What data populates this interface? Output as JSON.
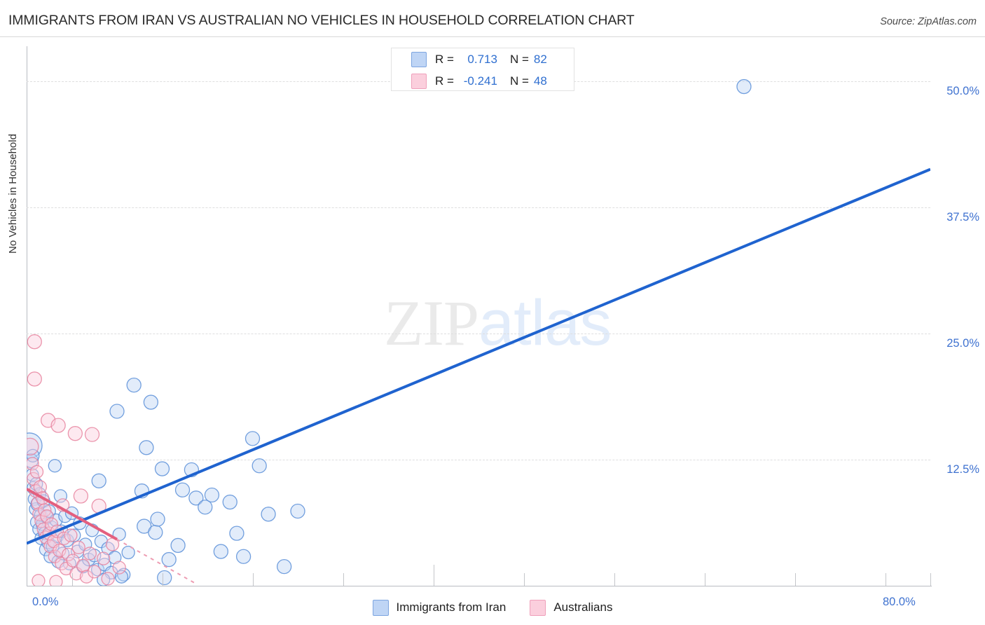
{
  "header": {
    "title": "IMMIGRANTS FROM IRAN VS AUSTRALIAN NO VEHICLES IN HOUSEHOLD CORRELATION CHART",
    "source": "Source: ZipAtlas.com"
  },
  "watermark": {
    "part1": "ZIP",
    "part2": "atlas"
  },
  "stats_legend": {
    "rows": [
      {
        "color": "#bfd5f5",
        "r_label": "R =",
        "r_value": "0.713",
        "n_label": "N =",
        "n_value": "82"
      },
      {
        "color": "#fbcfdd",
        "r_label": "R =",
        "r_value": "-0.241",
        "n_label": "N =",
        "n_value": "48"
      }
    ]
  },
  "bottom_legend": {
    "items": [
      {
        "label": "Immigrants from Iran",
        "color": "#bfd5f5",
        "border": "#7da5e0"
      },
      {
        "label": "Australians",
        "color": "#fbcfdd",
        "border": "#efa0bb"
      }
    ]
  },
  "chart_data": {
    "type": "scatter",
    "title": "IMMIGRANTS FROM IRAN VS AUSTRALIAN NO VEHICLES IN HOUSEHOLD CORRELATION CHART",
    "xlabel": "",
    "ylabel": "No Vehicles in Household",
    "xlim": [
      0,
      80
    ],
    "ylim": [
      0,
      53.5
    ],
    "grid": true,
    "legend_position": "bottom-center",
    "y_ticks": [
      {
        "value": 50.0,
        "label": "50.0%"
      },
      {
        "value": 37.5,
        "label": "37.5%"
      },
      {
        "value": 25.0,
        "label": "25.0%"
      },
      {
        "value": 12.5,
        "label": "12.5%"
      }
    ],
    "x_ticks": [
      {
        "value": 0,
        "label": "0.0%"
      },
      {
        "value": 80,
        "label": "80.0%"
      }
    ],
    "x_tick_marks": [
      4,
      12,
      20,
      28,
      36,
      44,
      52,
      60,
      68,
      76,
      80
    ],
    "series": [
      {
        "name": "Immigrants from Iran",
        "color": "#bfd5f5",
        "border": "#5b8fd8",
        "r": 0.713,
        "n": 82,
        "trendline": {
          "x0": 0,
          "y0": 4.2,
          "x1": 80,
          "y1": 41.3,
          "color": "#1f63cf",
          "style": "solid"
        },
        "points": [
          [
            0.25,
            13.9,
            18
          ],
          [
            0.4,
            12.4,
            10
          ],
          [
            0.5,
            11.0,
            9
          ],
          [
            0.55,
            12.9,
            9
          ],
          [
            0.6,
            9.7,
            9
          ],
          [
            0.7,
            8.6,
            9
          ],
          [
            0.8,
            7.6,
            9
          ],
          [
            0.85,
            10.1,
            9
          ],
          [
            0.9,
            6.3,
            9
          ],
          [
            1.0,
            8.1,
            10
          ],
          [
            1.1,
            5.6,
            9
          ],
          [
            1.15,
            9.1,
            9
          ],
          [
            1.25,
            7.0,
            9
          ],
          [
            1.3,
            4.7,
            9
          ],
          [
            1.4,
            6.1,
            9
          ],
          [
            1.5,
            8.4,
            9
          ],
          [
            1.6,
            5.2,
            9
          ],
          [
            1.7,
            3.6,
            9
          ],
          [
            1.8,
            6.8,
            9
          ],
          [
            1.9,
            4.3,
            9
          ],
          [
            2.0,
            7.4,
            9
          ],
          [
            2.1,
            2.9,
            9
          ],
          [
            2.2,
            5.8,
            9
          ],
          [
            2.3,
            3.9,
            9
          ],
          [
            2.5,
            11.9,
            9
          ],
          [
            2.6,
            6.5,
            9
          ],
          [
            2.7,
            4.9,
            9
          ],
          [
            2.8,
            2.4,
            9
          ],
          [
            3.0,
            8.9,
            9
          ],
          [
            3.1,
            5.4,
            9
          ],
          [
            3.2,
            3.2,
            9
          ],
          [
            3.4,
            6.9,
            9
          ],
          [
            3.6,
            4.5,
            9
          ],
          [
            3.8,
            2.2,
            9
          ],
          [
            4.0,
            7.2,
            9
          ],
          [
            4.2,
            5.0,
            9
          ],
          [
            4.5,
            3.4,
            9
          ],
          [
            4.7,
            6.2,
            9
          ],
          [
            5.0,
            1.9,
            9
          ],
          [
            5.2,
            4.1,
            9
          ],
          [
            5.5,
            2.6,
            9
          ],
          [
            5.8,
            5.5,
            9
          ],
          [
            6.0,
            3.0,
            9
          ],
          [
            6.3,
            1.6,
            9
          ],
          [
            6.6,
            4.4,
            9
          ],
          [
            6.9,
            2.1,
            9
          ],
          [
            7.2,
            3.7,
            9
          ],
          [
            7.5,
            1.3,
            9
          ],
          [
            6.4,
            10.4,
            10
          ],
          [
            7.8,
            2.8,
            9
          ],
          [
            8.2,
            5.1,
            9
          ],
          [
            8.6,
            1.1,
            9
          ],
          [
            9.0,
            3.3,
            9
          ],
          [
            8.0,
            17.3,
            10
          ],
          [
            9.5,
            19.9,
            10
          ],
          [
            10.6,
            13.7,
            10
          ],
          [
            11.0,
            18.2,
            10
          ],
          [
            10.2,
            9.4,
            10
          ],
          [
            10.4,
            5.9,
            10
          ],
          [
            11.4,
            5.3,
            10
          ],
          [
            11.6,
            6.6,
            10
          ],
          [
            12.0,
            11.6,
            10
          ],
          [
            12.6,
            2.6,
            10
          ],
          [
            13.4,
            4.0,
            10
          ],
          [
            13.8,
            9.5,
            10
          ],
          [
            14.6,
            11.5,
            10
          ],
          [
            15.0,
            8.7,
            10
          ],
          [
            15.8,
            7.8,
            10
          ],
          [
            16.4,
            9.0,
            10
          ],
          [
            17.2,
            3.4,
            10
          ],
          [
            18.0,
            8.3,
            10
          ],
          [
            18.6,
            5.2,
            10
          ],
          [
            19.2,
            2.9,
            10
          ],
          [
            20.0,
            14.6,
            10
          ],
          [
            20.6,
            11.9,
            10
          ],
          [
            21.4,
            7.1,
            10
          ],
          [
            22.8,
            1.9,
            10
          ],
          [
            24.0,
            7.4,
            10
          ],
          [
            12.2,
            0.8,
            10
          ],
          [
            6.8,
            0.6,
            9
          ],
          [
            8.4,
            0.9,
            9
          ],
          [
            63.5,
            49.5,
            10
          ]
        ]
      },
      {
        "name": "Australians",
        "color": "#fbcfdd",
        "border": "#e8849f",
        "r": -0.241,
        "n": 48,
        "trendline": {
          "x0": 0,
          "y0": 9.6,
          "x1": 8.0,
          "y1": 4.6,
          "color": "#e3607f",
          "style": "solid"
        },
        "trendline_dashed": {
          "x0": 8.0,
          "y0": 4.6,
          "x1": 15.0,
          "y1": 0.2,
          "color": "#ee9cb2",
          "style": "dashed"
        },
        "points": [
          [
            0.7,
            24.2,
            10
          ],
          [
            0.7,
            20.5,
            10
          ],
          [
            1.9,
            16.4,
            10
          ],
          [
            2.8,
            15.9,
            10
          ],
          [
            4.3,
            15.1,
            10
          ],
          [
            5.8,
            15.0,
            10
          ],
          [
            0.3,
            13.8,
            12
          ],
          [
            0.5,
            12.1,
            9
          ],
          [
            0.6,
            10.6,
            9
          ],
          [
            0.8,
            9.4,
            9
          ],
          [
            0.9,
            11.3,
            9
          ],
          [
            1.0,
            8.2,
            9
          ],
          [
            1.1,
            7.1,
            9
          ],
          [
            1.2,
            9.8,
            9
          ],
          [
            1.3,
            6.4,
            9
          ],
          [
            1.4,
            8.7,
            9
          ],
          [
            1.5,
            5.6,
            9
          ],
          [
            1.6,
            7.5,
            9
          ],
          [
            1.7,
            4.8,
            9
          ],
          [
            1.8,
            6.9,
            9
          ],
          [
            2.0,
            5.2,
            9
          ],
          [
            2.1,
            3.9,
            9
          ],
          [
            2.2,
            6.1,
            9
          ],
          [
            2.4,
            4.4,
            9
          ],
          [
            2.5,
            2.9,
            9
          ],
          [
            2.7,
            5.4,
            9
          ],
          [
            2.9,
            3.5,
            9
          ],
          [
            3.1,
            2.2,
            9
          ],
          [
            3.3,
            4.7,
            9
          ],
          [
            3.5,
            1.7,
            9
          ],
          [
            3.7,
            3.1,
            9
          ],
          [
            3.9,
            5.0,
            9
          ],
          [
            4.1,
            2.5,
            9
          ],
          [
            4.4,
            1.2,
            9
          ],
          [
            4.6,
            3.8,
            9
          ],
          [
            5.0,
            2.0,
            9
          ],
          [
            5.3,
            0.9,
            9
          ],
          [
            5.6,
            3.2,
            9
          ],
          [
            6.0,
            1.4,
            9
          ],
          [
            6.4,
            7.9,
            10
          ],
          [
            6.8,
            2.7,
            9
          ],
          [
            7.2,
            0.7,
            9
          ],
          [
            7.6,
            4.1,
            9
          ],
          [
            8.2,
            1.8,
            9
          ],
          [
            4.8,
            8.9,
            10
          ],
          [
            3.2,
            8.0,
            9
          ],
          [
            1.05,
            0.5,
            9
          ],
          [
            2.6,
            0.4,
            9
          ]
        ]
      }
    ]
  },
  "axis": {
    "y_title": "No Vehicles in Household"
  }
}
